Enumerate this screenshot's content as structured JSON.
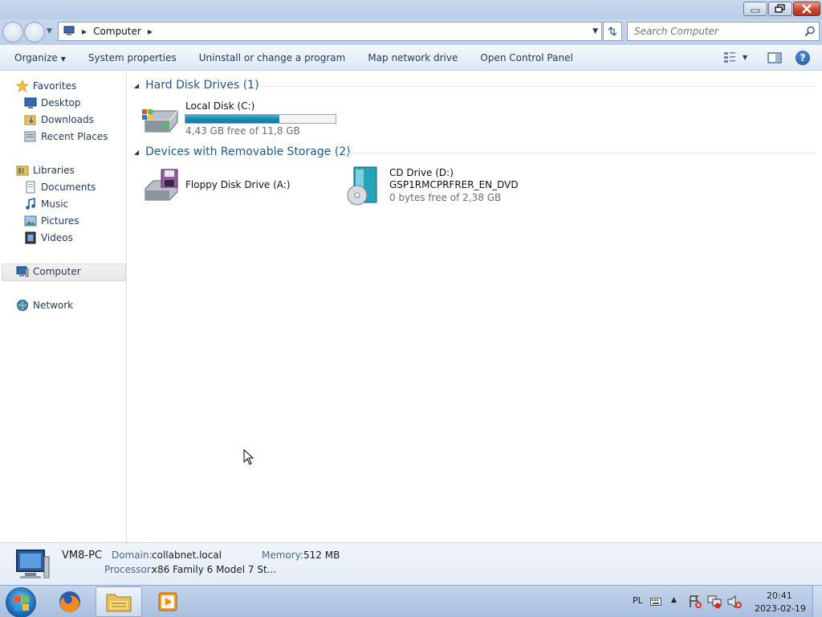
{
  "window": {
    "minimize_icon": "minimize-icon",
    "maximize_icon": "restore-icon",
    "close_icon": "close-icon"
  },
  "address": {
    "breadcrumb": "Computer",
    "search_placeholder": "Search Computer"
  },
  "toolbar": {
    "organize": "Organize",
    "system_properties": "System properties",
    "uninstall": "Uninstall or change a program",
    "map_drive": "Map network drive",
    "control_panel": "Open Control Panel"
  },
  "sidebar": {
    "favorites": "Favorites",
    "desktop": "Desktop",
    "downloads": "Downloads",
    "recent_places": "Recent Places",
    "libraries": "Libraries",
    "documents": "Documents",
    "music": "Music",
    "pictures": "Pictures",
    "videos": "Videos",
    "computer": "Computer",
    "network": "Network"
  },
  "groups": {
    "hdd": "Hard Disk Drives (1)",
    "removable": "Devices with Removable Storage (2)"
  },
  "drives": {
    "c": {
      "name": "Local Disk (C:)",
      "free": "4,43 GB free of 11,8 GB",
      "used_fraction": 0.625
    },
    "a": {
      "name": "Floppy Disk Drive (A:)"
    },
    "d": {
      "name": "CD Drive (D:)",
      "label": "GSP1RMCPRFRER_EN_DVD",
      "free": "0 bytes free of 2,38 GB"
    }
  },
  "details": {
    "computer_name": "VM8-PC",
    "domain_label": "Domain:",
    "domain_value": "collabnet.local",
    "memory_label": "Memory:",
    "memory_value": "512 MB",
    "processor_label": "Processor:",
    "processor_value": "x86 Family 6 Model 7 St..."
  },
  "taskbar": {
    "lang": "PL",
    "time": "20:41",
    "date": "2023-02-19"
  },
  "colors": {
    "accent": "#1e5799",
    "progress": "#1a8bb3"
  }
}
